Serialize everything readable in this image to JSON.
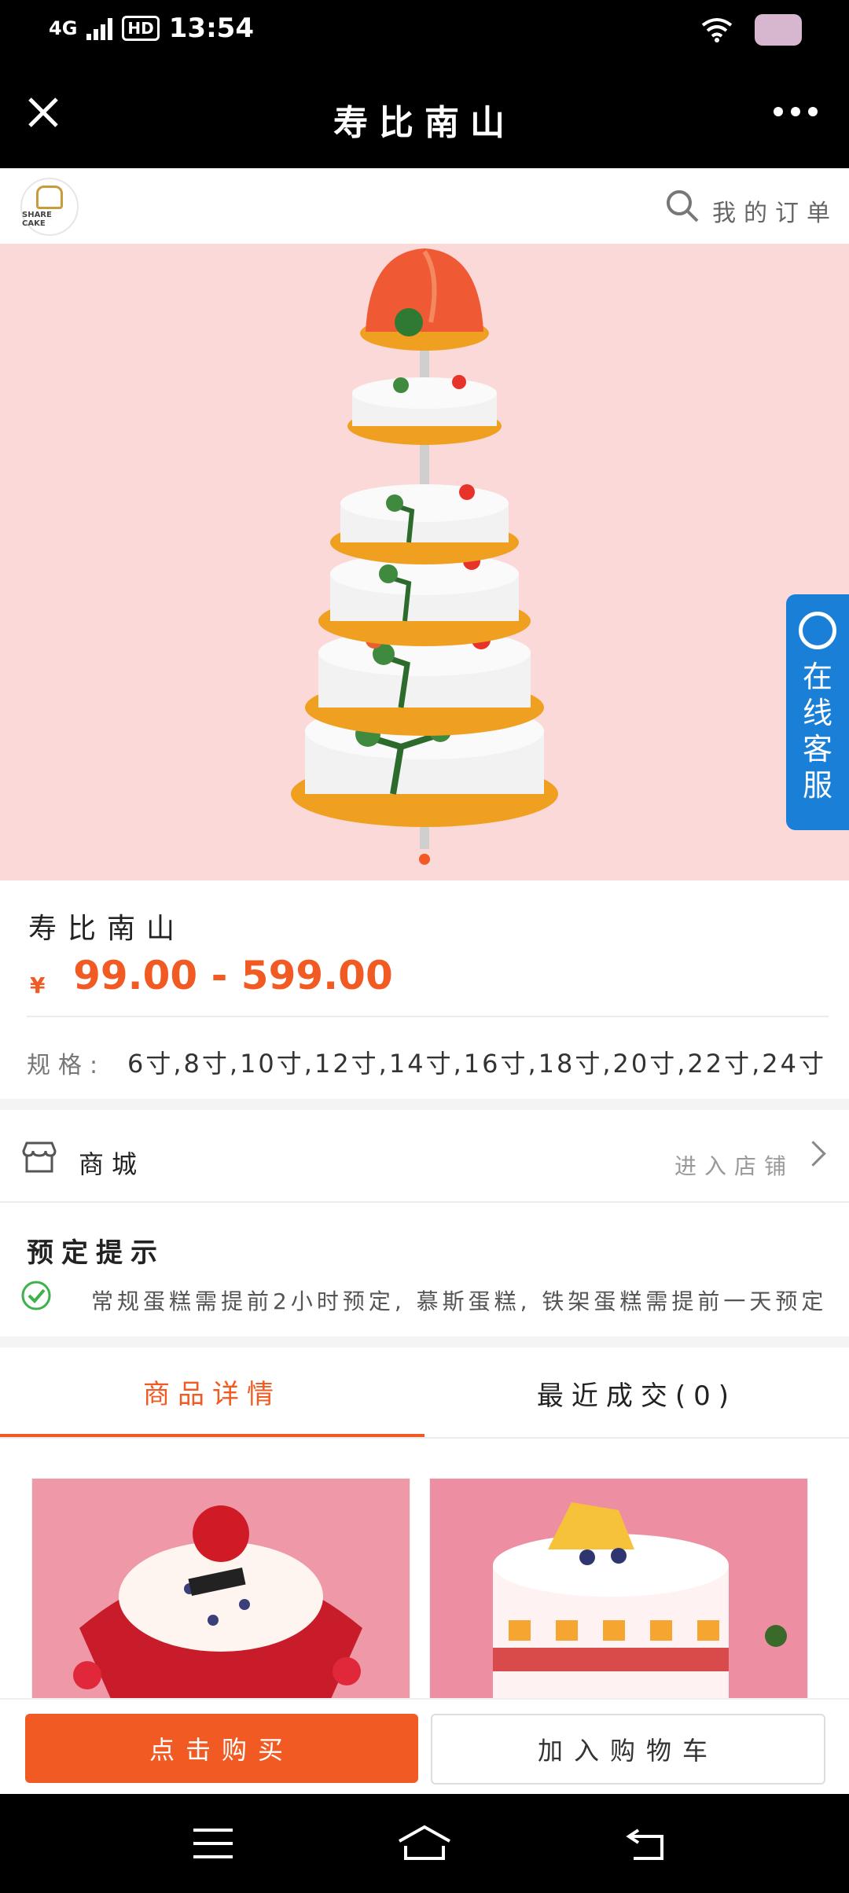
{
  "status_bar": {
    "network": "4G",
    "hd": "HD",
    "time": "13:54"
  },
  "title_bar": {
    "title": "寿比南山"
  },
  "shop_header": {
    "logo_text": "SHARE CAKE",
    "my_orders": "我的订单"
  },
  "banner": {
    "service_label": "在线客服"
  },
  "product": {
    "name": "寿比南山",
    "currency": "¥",
    "price_range": "99.00 - 599.00",
    "spec_label": "规格:",
    "spec_values": "6寸,8寸,10寸,12寸,14寸,16寸,18寸,20寸,22寸,24寸"
  },
  "store": {
    "label": "商城",
    "enter": "进入店铺"
  },
  "notice": {
    "title": "预定提示",
    "text": "常规蛋糕需提前2小时预定, 慕斯蛋糕, 铁架蛋糕需提前一天预定"
  },
  "tabs": [
    {
      "label": "商品详情",
      "active": true
    },
    {
      "label": "最近成交(0)",
      "active": false
    }
  ],
  "actions": {
    "buy": "点击购买",
    "cart": "加入购物车"
  },
  "colors": {
    "accent": "#f15a22",
    "banner_bg": "#fcd9d9",
    "service_blue": "#1a7fd6"
  }
}
